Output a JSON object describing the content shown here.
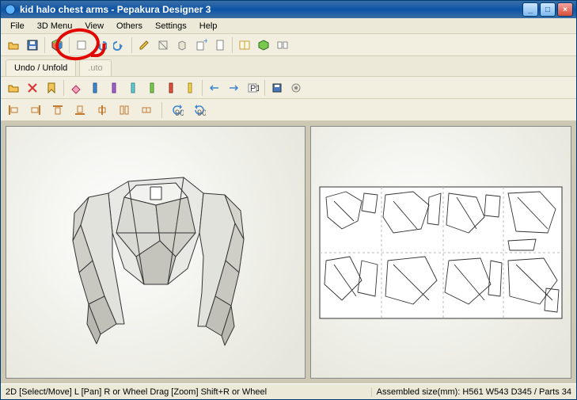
{
  "title": "kid halo chest arms - Pepakura Designer 3",
  "menus": [
    "File",
    "3D Menu",
    "View",
    "Others",
    "Settings",
    "Help"
  ],
  "toolbar_row1_icons": [
    "open-icon",
    "save-icon",
    "cube-color-icon",
    "edit-icon",
    "undo-icon",
    "redo-icon",
    "pencil-icon",
    "cut-icon",
    "box-icon",
    "add-icon",
    "page-icon",
    "book-icon",
    "green-accent-icon",
    "swap-icon"
  ],
  "tab_labels": {
    "active": "Undo / Unfold",
    "inactive": ".uto"
  },
  "toolbar_row2_icons": [
    "open-icon",
    "cut-red-icon",
    "bookmark-icon",
    "eraser-icon",
    "col-blue-icon",
    "col-violet-icon",
    "col-cyan-icon",
    "col-green-icon",
    "col-red-icon",
    "col-yellow-icon",
    "arrows1-icon",
    "arrows2-icon",
    "p1-icon",
    "save-small-icon",
    "config-icon"
  ],
  "toolbar_row3_icons": [
    "align-left-icon",
    "align-right-icon",
    "align-top-icon",
    "align-bottom-icon",
    "align-center-icon",
    "merge-icon",
    "split-icon",
    "rotate-ccw-icon",
    "rotate-cw-icon"
  ],
  "status": {
    "left": "2D [Select/Move] L [Pan] R or Wheel Drag [Zoom] Shift+R or Wheel",
    "right": "Assembled size(mm): H561 W543 D345 / Parts 34"
  },
  "annotation": {
    "highlight": "cube-color-icon (3D colored model toggle)",
    "color": "#e10600"
  },
  "view": {
    "left_pane": "3D low-poly armor torso model (grey shaded)",
    "right_pane": "unfolded paper pattern sheet with part outlines"
  }
}
